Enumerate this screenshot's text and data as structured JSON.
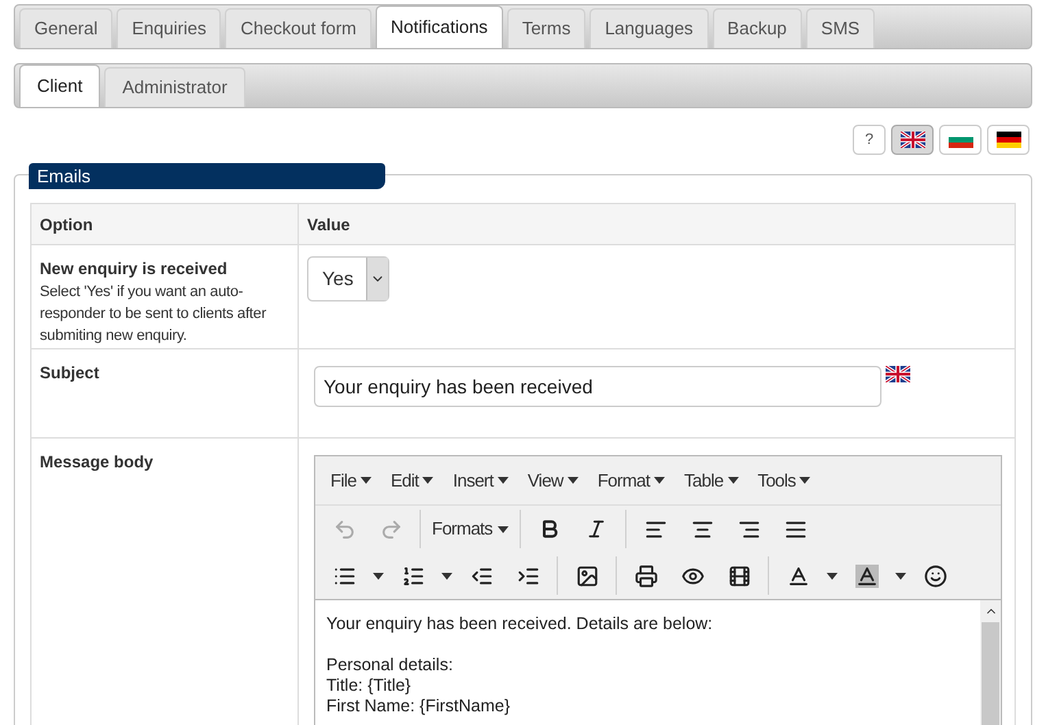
{
  "tabs": [
    {
      "label": "General",
      "selected": false
    },
    {
      "label": "Enquiries",
      "selected": false
    },
    {
      "label": "Checkout form",
      "selected": false
    },
    {
      "label": "Notifications",
      "selected": true
    },
    {
      "label": "Terms",
      "selected": false
    },
    {
      "label": "Languages",
      "selected": false
    },
    {
      "label": "Backup",
      "selected": false
    },
    {
      "label": "SMS",
      "selected": false
    }
  ],
  "subtabs": [
    {
      "label": "Client",
      "selected": true
    },
    {
      "label": "Administrator",
      "selected": false
    }
  ],
  "help_button": "?",
  "languages": [
    {
      "kind": "uk",
      "selected": true
    },
    {
      "kind": "bg",
      "selected": false
    },
    {
      "kind": "de",
      "selected": false
    }
  ],
  "section_title": "Emails",
  "table": {
    "columns": [
      "Option",
      "Value"
    ],
    "rows": [
      {
        "kind": "select",
        "label": "New enquiry is received",
        "hint": "Select 'Yes' if you want an auto-responder to be sent to clients after submiting new enquiry.",
        "value": "Yes"
      },
      {
        "kind": "input",
        "label": "Subject",
        "value": "Your enquiry has been received"
      },
      {
        "kind": "editor",
        "label": "Message body"
      }
    ]
  },
  "editor": {
    "menu": [
      "File",
      "Edit",
      "Insert",
      "View",
      "Format",
      "Table",
      "Tools"
    ],
    "toolbar_rows": [
      [
        {
          "kind": "undo",
          "disabled": true
        },
        {
          "kind": "redo",
          "disabled": true
        },
        {
          "kind": "sep"
        },
        {
          "kind": "formats",
          "label": "Formats",
          "disabled": false
        },
        {
          "kind": "sep"
        },
        {
          "kind": "bold",
          "disabled": false
        },
        {
          "kind": "italic",
          "disabled": false
        },
        {
          "kind": "sep"
        },
        {
          "kind": "align-left",
          "disabled": false
        },
        {
          "kind": "align-center",
          "disabled": false
        },
        {
          "kind": "align-right",
          "disabled": false
        },
        {
          "kind": "align-justify",
          "disabled": false
        }
      ],
      [
        {
          "kind": "bullets",
          "disabled": false
        },
        {
          "kind": "caret"
        },
        {
          "kind": "numbers",
          "disabled": false
        },
        {
          "kind": "caret"
        },
        {
          "kind": "outdent",
          "disabled": false
        },
        {
          "kind": "indent",
          "disabled": false
        },
        {
          "kind": "sep"
        },
        {
          "kind": "image",
          "disabled": false
        },
        {
          "kind": "sep"
        },
        {
          "kind": "print",
          "disabled": false
        },
        {
          "kind": "preview",
          "disabled": false
        },
        {
          "kind": "media",
          "disabled": false
        },
        {
          "kind": "sep"
        },
        {
          "kind": "text-color",
          "disabled": false
        },
        {
          "kind": "caret"
        },
        {
          "kind": "bg-color",
          "disabled": false
        },
        {
          "kind": "caret"
        },
        {
          "kind": "emoticons",
          "disabled": false
        }
      ]
    ],
    "paragraphs": [
      [
        "Your enquiry has been received. Details are below:"
      ],
      [
        "Personal details:",
        "Title: {Title}",
        "First Name: {FirstName}"
      ]
    ]
  }
}
